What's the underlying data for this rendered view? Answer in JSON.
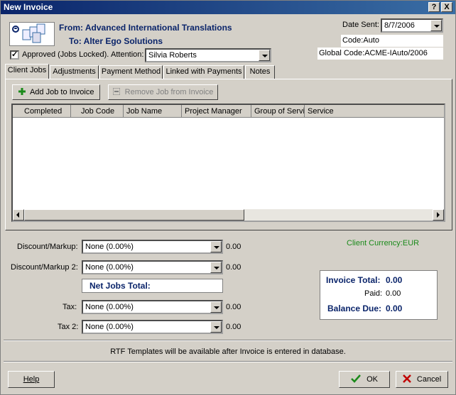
{
  "window": {
    "title": "New Invoice",
    "help_button": "?",
    "close_button": "X"
  },
  "header": {
    "from_label": "From:",
    "from_value": "Advanced International Translations",
    "to_label": "To:",
    "to_value": "Alter Ego Solutions",
    "approved_label": "Approved (Jobs Locked).",
    "approved_checked": "✓",
    "attention_label": "Attention:",
    "attention_value": "Silvia Roberts",
    "date_sent_label": "Date Sent:",
    "date_sent_value": "8/7/2006",
    "code": "Code:Auto",
    "global_code": "Global Code:ACME-IAuto/2006"
  },
  "tabs": [
    {
      "label": "Client Jobs"
    },
    {
      "label": "Adjustments"
    },
    {
      "label": "Payment Method"
    },
    {
      "label": "Linked with Payments"
    },
    {
      "label": "Notes"
    }
  ],
  "client_jobs": {
    "add_button": "Add Job to Invoice",
    "remove_button": "Remove Job from Invoice",
    "columns": [
      "Completed",
      "Job Code",
      "Job Name",
      "Project Manager",
      "Group of Servi",
      "Service"
    ]
  },
  "adjustments": {
    "discount1_label": "Discount/Markup:",
    "discount1_value": "None (0.00%)",
    "discount1_amount": "0.00",
    "discount2_label": "Discount/Markup 2:",
    "discount2_value": "None (0.00%)",
    "discount2_amount": "0.00",
    "net_jobs_total_label": "Net Jobs Total:",
    "tax1_label": "Tax:",
    "tax1_value": "None (0.00%)",
    "tax1_amount": "0.00",
    "tax2_label": "Tax 2:",
    "tax2_value": "None (0.00%)",
    "tax2_amount": "0.00"
  },
  "summary": {
    "client_currency": "Client Currency:EUR",
    "invoice_total_label": "Invoice Total:",
    "invoice_total_value": "0.00",
    "paid_label": "Paid:",
    "paid_value": "0.00",
    "balance_due_label": "Balance Due:",
    "balance_due_value": "0.00"
  },
  "footer": {
    "rtf_note": "RTF Templates will be available after Invoice is entered in database.",
    "help_button": "Help",
    "ok_button": "OK",
    "cancel_button": "Cancel"
  },
  "colors": {
    "title_bar": "#0a246a",
    "accent_text": "#0a246a",
    "currency_text": "#1a8a1a",
    "ok_check": "#1a8a1a",
    "cancel_x": "#c00000",
    "add_plus": "#1a8a1a"
  }
}
